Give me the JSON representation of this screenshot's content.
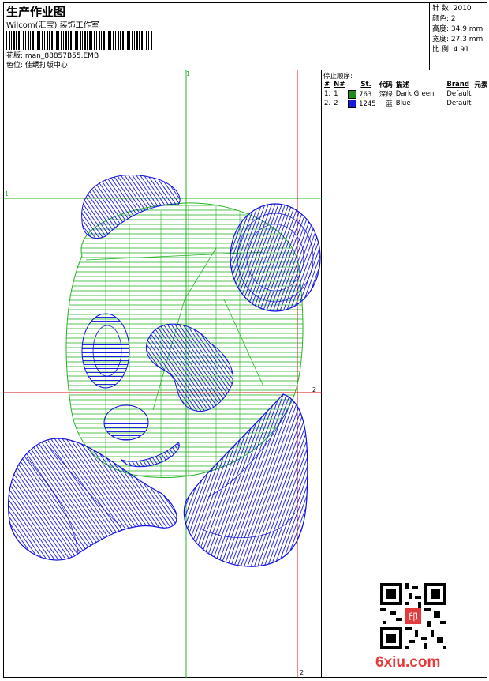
{
  "header": {
    "title": "生产作业图",
    "company": "Wilcom(汇宝) 装饰工作室",
    "design_file": "花版: man_88857B55.EMB",
    "color_position": "色位: 佳绣打版中心"
  },
  "stats": {
    "stitches": "针 数: 2010",
    "colors": "颜色: 2",
    "height": "高度: 34.9 mm",
    "width": "宽度: 27.3 mm",
    "scale": "比 例: 4.91"
  },
  "stop_sequence": {
    "label": "停止顺序:",
    "columns": [
      "#",
      "N#",
      "St.",
      "代码",
      "描述",
      "Brand",
      "元素"
    ],
    "rows": [
      {
        "idx": "1.",
        "n": "1",
        "stitches": "763",
        "code": "深绿",
        "desc": "Dark Green",
        "brand": "Default",
        "color": "#1e8c1e"
      },
      {
        "idx": "2.",
        "n": "2",
        "stitches": "1245",
        "code": "蓝",
        "desc": "Blue",
        "brand": "Default",
        "color": "#1a1adc"
      }
    ]
  },
  "guides": {
    "green_label_v": "1",
    "green_label_h": "1",
    "red_label_h": "2",
    "red_label_v": "2"
  },
  "colors": {
    "green": "#22b422",
    "blue": "#1010e0",
    "red": "#d21414"
  },
  "watermark": {
    "logo": "6xiu.com",
    "stamp": "印"
  }
}
